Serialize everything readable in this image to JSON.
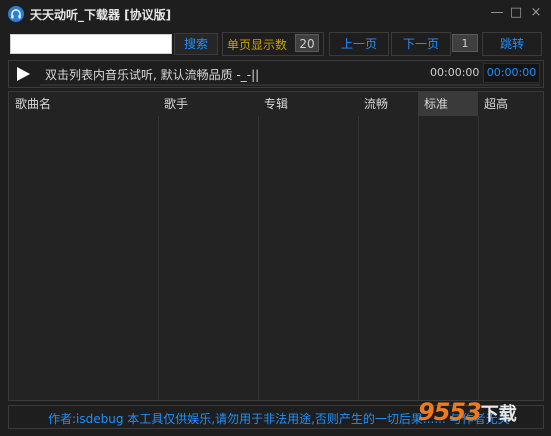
{
  "window": {
    "title": "天天动听_下载器 [协议版]",
    "minimize_glyph": "—",
    "maximize_glyph": "□",
    "close_glyph": "×"
  },
  "toolbar": {
    "search_value": "",
    "search_label": "搜索",
    "per_page_label": "单页显示数",
    "per_page_value": "20",
    "prev_label": "上一页",
    "next_label": "下一页",
    "page_value": "1",
    "jump_label": "跳转"
  },
  "player": {
    "status": "双击列表内音乐试听, 默认流畅品质 -_-||",
    "time_current": "00:00:00",
    "time_total": "00:00:00",
    "progress": 0
  },
  "table": {
    "columns": [
      "歌曲名",
      "歌手",
      "专辑",
      "流畅",
      "标准",
      "超高"
    ],
    "active_column": 4,
    "rows": []
  },
  "footer": {
    "text": "作者:isdebug  本工具仅供娱乐,请勿用于非法用途,否则产生的一切后果...... 与作者无关"
  },
  "watermark": {
    "digits": "9553",
    "text": "下载"
  },
  "colors": {
    "accent": "#1e90ff",
    "label_gold": "#c7a100",
    "background": "#1e1e1e"
  }
}
